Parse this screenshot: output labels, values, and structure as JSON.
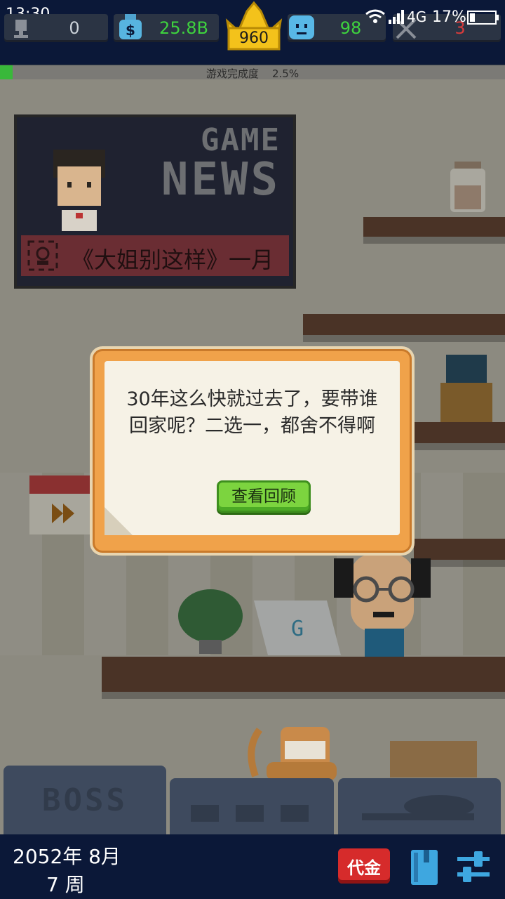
{
  "status_bar": {
    "time": "13:30",
    "network": "4G",
    "battery": "17%"
  },
  "resources": {
    "trophy": "0",
    "money": "25.8B",
    "crown_level": "960",
    "fans": "98",
    "hidden": "3"
  },
  "progress": {
    "label": "游戏完成度",
    "percent_text": "2.5%",
    "fraction": 0.025
  },
  "news_board": {
    "title_line1": "GAME",
    "title_line2": "NEWS",
    "ticker": "《大姐别这样》一月"
  },
  "dialog": {
    "message": "30年这么快就过去了，要带谁回家呢？二选一，都舍不得啊",
    "button_label": "查看回顾"
  },
  "bottom_bar": {
    "date_line1": "2052年 8月",
    "date_line2": "7 周",
    "voucher_label": "代金"
  },
  "desk_tabs": [
    "BOSS",
    "",
    ""
  ],
  "colors": {
    "bar_bg": "#0b1838",
    "money_green": "#3ed23e",
    "fans_green": "#3ed23e",
    "accent_orange": "#f0a24a"
  }
}
